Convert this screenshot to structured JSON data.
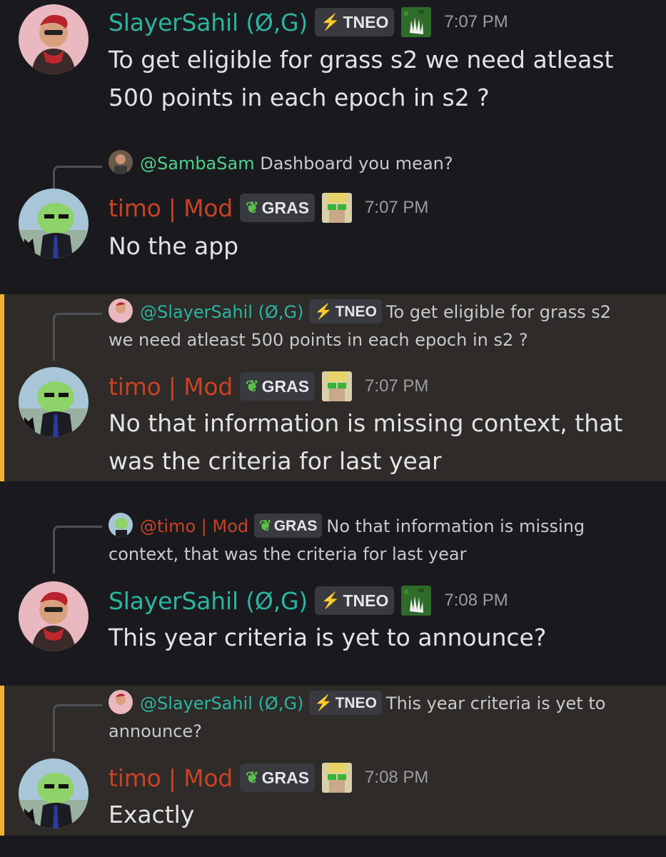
{
  "messages": [
    {
      "author": "SlayerSahil (Ø,G)",
      "tag": "TNEO",
      "time": "7:07 PM",
      "lines": [
        "To get eligible for grass s2 we need atleast",
        "500 points in each epoch in s2 ?"
      ]
    },
    {
      "reply": {
        "at": "@SambaSam",
        "text": "Dashboard you mean?"
      },
      "author": "timo | Mod",
      "tag": "GRAS",
      "time": "7:07 PM",
      "lines": [
        "No the app"
      ]
    },
    {
      "reply": {
        "at": "@SlayerSahil (Ø,G)",
        "tag": "TNEO",
        "text1": "To get eligible for grass s2",
        "text2": "we need atleast 500 points in each epoch in s2 ?"
      },
      "author": "timo | Mod",
      "tag": "GRAS",
      "time": "7:07 PM",
      "lines": [
        "No that information is missing context, that",
        "was the criteria for last year"
      ]
    },
    {
      "reply": {
        "at": "@timo | Mod",
        "tag": "GRAS",
        "text1": "No that information is missing",
        "text2": "context, that was the criteria for last year"
      },
      "author": "SlayerSahil (Ø,G)",
      "tag": "TNEO",
      "time": "7:08 PM",
      "lines": [
        "This year criteria is yet to announce?"
      ]
    },
    {
      "reply": {
        "at": "@SlayerSahil (Ø,G)",
        "tag": "TNEO",
        "text1": "This year criteria is yet to",
        "text2": "announce?"
      },
      "author": "timo | Mod",
      "tag": "GRAS",
      "time": "7:08 PM",
      "lines": [
        "Exactly"
      ]
    }
  ],
  "icons": {
    "tneo": "lightning-bolt-icon",
    "gras": "leaf-icon"
  },
  "colors": {
    "highlight_bar": "#f0b232",
    "highlight_bg": "#2e2b28",
    "sahil": "#2bb5a0",
    "timo": "#c84226"
  }
}
